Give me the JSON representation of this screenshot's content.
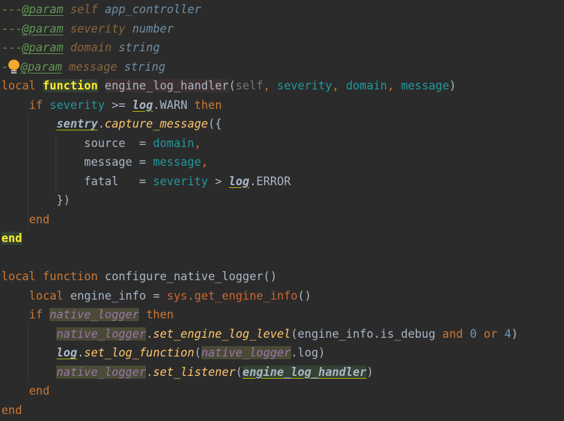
{
  "editor": {
    "language": "lua",
    "intention_icon": "lightbulb-icon",
    "lines": {
      "l1": {
        "dashes": "---",
        "tag": "@param",
        "name": "self",
        "type": "app_controller"
      },
      "l2": {
        "dashes": "---",
        "tag": "@param",
        "name": "severity",
        "type": "number"
      },
      "l3": {
        "dashes": "---",
        "tag": "@param",
        "name": "domain",
        "type": "string"
      },
      "l4": {
        "dashes": "-",
        "tag": "@param",
        "name": "message",
        "type": "string"
      },
      "l5": {
        "local": "local",
        "function": "function",
        "name": "engine_log_handler",
        "open": "(",
        "p_self": "self",
        "c1": ",",
        "p_sev": " severity",
        "c2": ",",
        "p_dom": " domain",
        "c3": ",",
        "p_msg": " message",
        "close": ")"
      },
      "l6": {
        "if": "if",
        "var": "severity",
        "op": " >= ",
        "glob": "log",
        "field": ".WARN",
        "then": "then"
      },
      "l7": {
        "glob": "sentry",
        "dot": ".",
        "method": "capture_message",
        "open": "({"
      },
      "l8": {
        "key": "source  = ",
        "val": "domain",
        "comma": ","
      },
      "l9": {
        "key": "message = ",
        "val": "message",
        "comma": ","
      },
      "l10": {
        "key": "fatal   = ",
        "val": "severity",
        "op": " > ",
        "glob": "log",
        "field": ".ERROR"
      },
      "l11": {
        "text": "})"
      },
      "l12": {
        "text": "end"
      },
      "l13": {
        "text": "end"
      },
      "l14": {
        "local": "local",
        "function": "function",
        "name": "configure_native_logger",
        "parens": "()"
      },
      "l15": {
        "local": "local",
        "var": "engine_info = ",
        "call": "sys.get_engine_info",
        "parens": "()"
      },
      "l16": {
        "if": "if",
        "var": "native_logger",
        "then": "then"
      },
      "l17": {
        "obj": "native_logger",
        "dot": ".",
        "method": "set_engine_log_level",
        "open": "(engine_info.is_debug ",
        "and": "and",
        "zero": "0",
        "or": "or",
        "four": "4",
        "close": ")"
      },
      "l18": {
        "glob": "log",
        "dot": ".",
        "method": "set_log_function",
        "open": "(",
        "obj": "native_logger",
        "rest": ".log)"
      },
      "l19": {
        "obj": "native_logger",
        "dot": ".",
        "method": "set_listener",
        "open": "(",
        "handler": "engine_log_handler",
        "close": ")"
      },
      "l20": {
        "text": "end"
      },
      "l21": {
        "text": "end"
      }
    }
  }
}
